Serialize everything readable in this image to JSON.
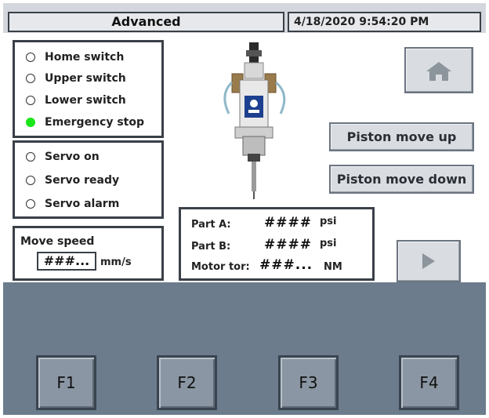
{
  "header": {
    "title": "Advanced",
    "datetime": "4/18/2020 9:54:20 PM"
  },
  "limit_switches": [
    {
      "label": "Home switch",
      "active": false
    },
    {
      "label": "Upper switch",
      "active": false
    },
    {
      "label": "Lower switch",
      "active": false
    },
    {
      "label": "Emergency stop",
      "active": true
    }
  ],
  "servo_status": [
    {
      "label": "Servo on",
      "active": false
    },
    {
      "label": "Servo ready",
      "active": false
    },
    {
      "label": "Servo alarm",
      "active": false
    }
  ],
  "move_speed": {
    "label": "Move speed",
    "value": "###...",
    "unit": "mm/s"
  },
  "readouts": {
    "part_a": {
      "label": "Part A:",
      "value": "####",
      "unit": "psi"
    },
    "part_b": {
      "label": "Part B:",
      "value": "####",
      "unit": "psi"
    },
    "motor_torque": {
      "label": "Motor tor:",
      "value": "###...",
      "unit": "NM"
    }
  },
  "buttons": {
    "home_icon": "home-icon",
    "piston_up": "Piston move up",
    "piston_down": "Piston move down",
    "next_icon": "play-arrow-icon"
  },
  "function_keys": [
    "F1",
    "F2",
    "F3",
    "F4"
  ],
  "colors": {
    "led_on": "#19e619",
    "panel_bg": "#6c7c8c",
    "button_face": "#d9dce0"
  }
}
